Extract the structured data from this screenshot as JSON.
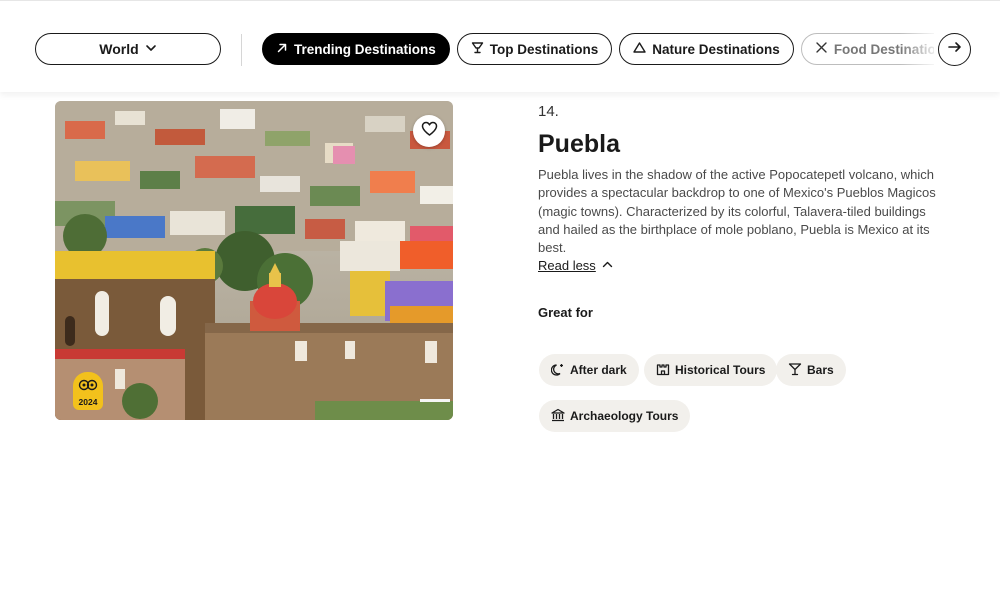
{
  "filters": {
    "region": "World",
    "chips": [
      {
        "label": "Trending Destinations",
        "icon": "trending-arrow-icon",
        "active": true
      },
      {
        "label": "Top Destinations",
        "icon": "trophy-icon",
        "active": false
      },
      {
        "label": "Nature Destinations",
        "icon": "mountain-icon",
        "active": false
      },
      {
        "label": "Food Destinations",
        "icon": "fork-knife-icon",
        "active": false
      }
    ]
  },
  "destination": {
    "rank": "14.",
    "name": "Puebla",
    "description": "Puebla lives in the shadow of the active Popocatepetl volcano, which provides a spectacular backdrop to one of Mexico's Pueblos Magicos (magic towns). Characterized by its colorful, Talavera-tiled buildings and hailed as the birthplace of mole poblano, Puebla is Mexico at its best.",
    "read_less": "Read less",
    "award_year": "2024",
    "great_for_label": "Great for",
    "tags": [
      {
        "label": "After dark",
        "icon": "moon-stars-icon"
      },
      {
        "label": "Historical Tours",
        "icon": "castle-icon"
      },
      {
        "label": "Bars",
        "icon": "cocktail-icon"
      },
      {
        "label": "Archaeology Tours",
        "icon": "museum-icon"
      }
    ]
  },
  "colors": {
    "active_chip": "#000000",
    "tag_background": "#f2f0ec",
    "award_badge": "#f2c11c"
  }
}
